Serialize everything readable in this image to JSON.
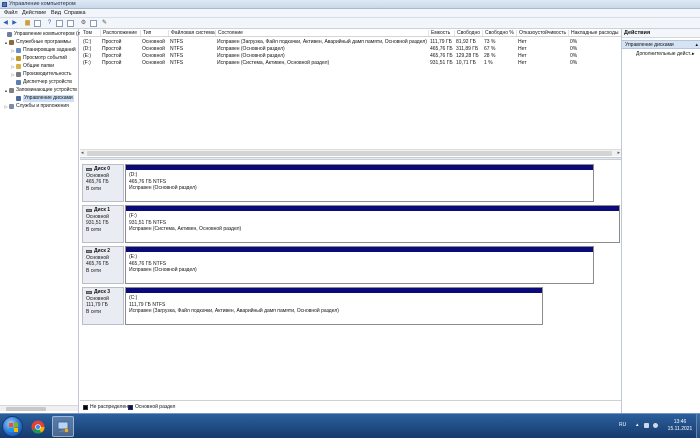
{
  "window": {
    "title": "Управление компьютером"
  },
  "menu": [
    "Файл",
    "Действие",
    "Вид",
    "Справка"
  ],
  "tree": {
    "items": [
      {
        "label": "Управление компьютером (л",
        "level": 0,
        "expander": "",
        "icon_color": "#6f7f99"
      },
      {
        "label": "Служебные программы",
        "level": 1,
        "expander": "▲",
        "icon_color": "#8a6a3a"
      },
      {
        "label": "Планировщик заданий",
        "level": 2,
        "expander": "▷",
        "icon_color": "#6a8cc2"
      },
      {
        "label": "Просмотр событий",
        "level": 2,
        "expander": "▷",
        "icon_color": "#c2962a"
      },
      {
        "label": "Общие папки",
        "level": 2,
        "expander": "▷",
        "icon_color": "#d6b34a"
      },
      {
        "label": "Производительность",
        "level": 2,
        "expander": "▷",
        "icon_color": "#7a7a7a"
      },
      {
        "label": "Диспетчер устройств",
        "level": 2,
        "expander": "",
        "icon_color": "#5b7fb0"
      },
      {
        "label": "Запоминающие устройств",
        "level": 1,
        "expander": "▲",
        "icon_color": "#808080"
      },
      {
        "label": "Управление дисками",
        "level": 2,
        "expander": "",
        "icon_color": "#4a6aa0",
        "selected": true
      },
      {
        "label": "Службы и приложения",
        "level": 1,
        "expander": "▷",
        "icon_color": "#7b8da8"
      }
    ]
  },
  "volumes": {
    "columns": [
      "Том",
      "Расположение",
      "Тип",
      "Файловая система",
      "Состояние",
      "Емкость",
      "Свободно",
      "Свободно %",
      "Отказоустойчивость",
      "Накладные расходы"
    ],
    "rows": [
      [
        "(C:)",
        "Простой",
        "Основной",
        "NTFS",
        "Исправен (Загрузка, Файл подкачки, Активен, Аварийный дамп памяти, Основной раздел)",
        "111,79 ГБ",
        "81,92 ГБ",
        "73 %",
        "Нет",
        "0%"
      ],
      [
        "(D:)",
        "Простой",
        "Основной",
        "NTFS",
        "Исправен (Основной раздел)",
        "465,76 ГБ",
        "311,89 ГБ",
        "67 %",
        "Нет",
        "0%"
      ],
      [
        "(E:)",
        "Простой",
        "Основной",
        "NTFS",
        "Исправен (Основной раздел)",
        "465,76 ГБ",
        "129,28 ГБ",
        "28 %",
        "Нет",
        "0%"
      ],
      [
        "(F:)",
        "Простой",
        "Основной",
        "NTFS",
        "Исправен (Система, Активен, Основной раздел)",
        "931,51 ГБ",
        "10,71 ГБ",
        "1 %",
        "Нет",
        "0%"
      ]
    ]
  },
  "disks": [
    {
      "name": "Диск 0",
      "kind": "Основной",
      "size": "465,76 ГБ",
      "status": "В сети",
      "partition": {
        "label": "(D:)",
        "size_fs": "465,76 ГБ NTFS",
        "state": "Исправен (Основной раздел)"
      }
    },
    {
      "name": "Диск 1",
      "kind": "Основной",
      "size": "931,51 ГБ",
      "status": "В сети",
      "partition": {
        "label": "(F:)",
        "size_fs": "931,51 ГБ NTFS",
        "state": "Исправен (Система, Активен, Основной раздел)"
      }
    },
    {
      "name": "Диск 2",
      "kind": "Основной",
      "size": "465,76 ГБ",
      "status": "В сети",
      "partition": {
        "label": "(E:)",
        "size_fs": "465,76 ГБ NTFS",
        "state": "Исправен (Основной раздел)"
      }
    },
    {
      "name": "Диск 3",
      "kind": "Основной",
      "size": "111,79 ГБ",
      "status": "В сети",
      "partition": {
        "label": "(C:)",
        "size_fs": "111,79 ГБ NTFS",
        "state": "Исправен (Загрузка, Файл подкачки, Активен, Аварийный дамп памяти, Основной раздел)"
      }
    }
  ],
  "legend": [
    {
      "label": "Не распределен",
      "color": "#000000"
    },
    {
      "label": "Основной раздел",
      "color": "#0a0a7a"
    }
  ],
  "actions": {
    "header": "Действия",
    "section": "Управление дисками",
    "item": "Дополнительные дейст..."
  },
  "taskbar": {
    "language": "RU",
    "time": "13:46",
    "date": "15.11.2021"
  }
}
